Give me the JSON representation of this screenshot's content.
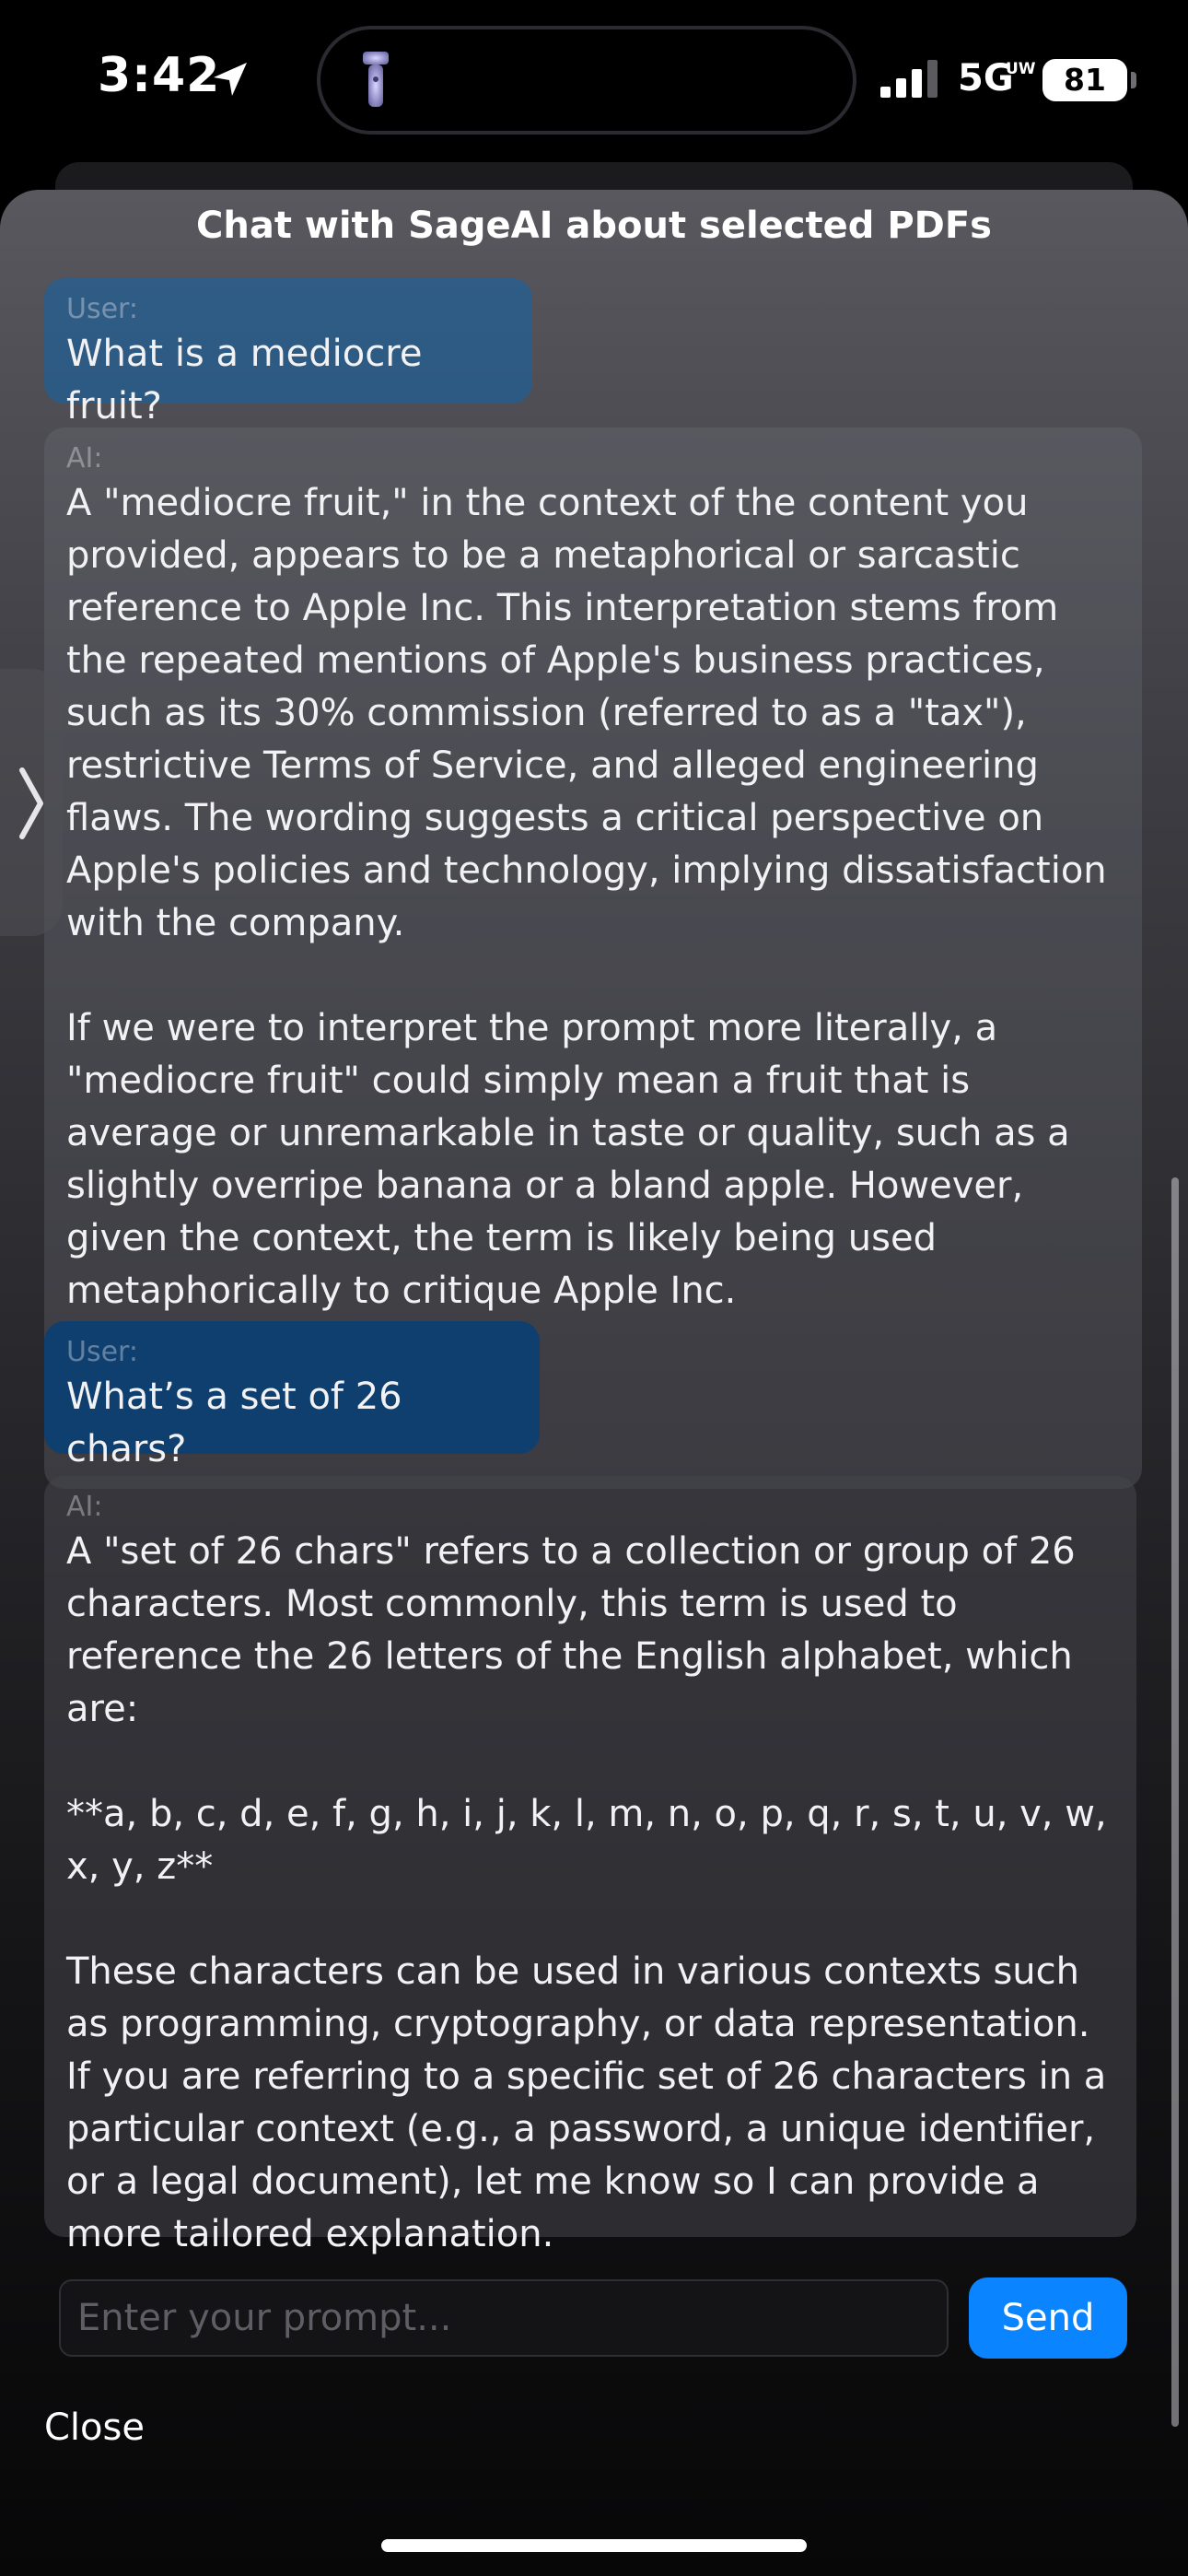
{
  "status_bar": {
    "time": "3:42",
    "network": "5G",
    "network_superscript": "UW",
    "battery": "81"
  },
  "sheet": {
    "title": "Chat with SageAI about selected PDFs"
  },
  "messages": [
    {
      "role_label": "User:",
      "text": "What is a mediocre fruit?"
    },
    {
      "role_label": "AI:",
      "text": "A \"mediocre fruit,\" in the context of the content you provided, appears to be a metaphorical or sarcastic reference to Apple Inc. This interpretation stems from the repeated mentions of Apple's business practices, such as its 30% commission (referred to as a \"tax\"), restrictive Terms of Service, and alleged engineering flaws. The wording suggests a critical perspective on Apple's policies and technology, implying dissatisfaction with the company.\n\nIf we were to interpret the prompt more literally, a \"mediocre fruit\" could simply mean a fruit that is average or unremarkable in taste or quality, such as a slightly overripe banana or a bland apple. However, given the context, the term is likely being used metaphorically to critique Apple Inc."
    },
    {
      "role_label": "User:",
      "text": "What’s a set of 26 chars?"
    },
    {
      "role_label": "AI:",
      "text": "A \"set of 26 chars\" refers to a collection or group of 26 characters. Most commonly, this term is used to reference the 26 letters of the English alphabet, which are:\n\n**a, b, c, d, e, f, g, h, i, j, k, l, m, n, o, p, q, r, s, t, u, v, w, x, y, z**\n\nThese characters can be used in various contexts such as programming, cryptography, or data representation. If you are referring to a specific set of 26 characters in a particular context (e.g., a password, a unique identifier, or a legal document), let me know so I can provide a more tailored explanation."
    }
  ],
  "composer": {
    "placeholder": "Enter your prompt...",
    "value": "",
    "send_label": "Send"
  },
  "close_label": "Close",
  "colors": {
    "accent": "#0a84ff",
    "user_bubble": "#1264aa",
    "background": "#000000"
  }
}
